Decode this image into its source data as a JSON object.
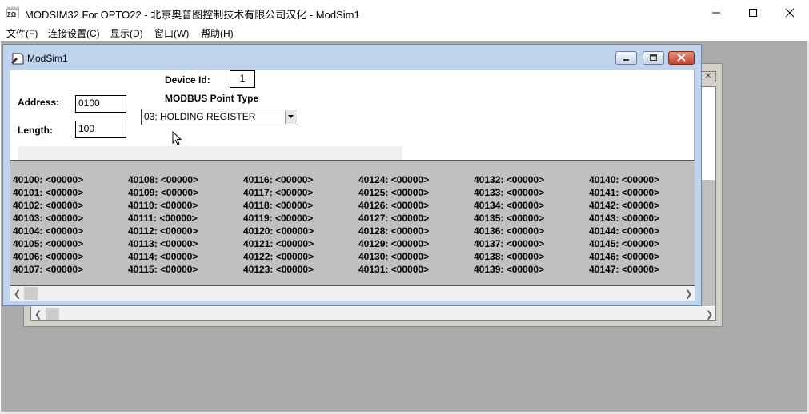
{
  "app": {
    "title": "MODSIM32 For OPTO22 - 北京奥普图控制技术有限公司汉化 - ModSim1",
    "icon": "modsim-app-icon"
  },
  "menu": [
    {
      "label": "文件(F)"
    },
    {
      "label": "连接设置(C)"
    },
    {
      "label": "显示(D)"
    },
    {
      "label": "窗口(W)"
    },
    {
      "label": "帮助(H)"
    }
  ],
  "child": {
    "title": "ModSim1",
    "address_label": "Address:",
    "address_value": "0100",
    "length_label": "Length:",
    "length_value": "100",
    "device_id_label": "Device Id:",
    "device_id_value": "1",
    "point_type_label": "MODBUS Point Type",
    "point_type_value": "03: HOLDING REGISTER"
  },
  "registers": {
    "columns": [
      [
        "40100: <00000>",
        "40101: <00000>",
        "40102: <00000>",
        "40103: <00000>",
        "40104: <00000>",
        "40105: <00000>",
        "40106: <00000>",
        "40107: <00000>"
      ],
      [
        "40108: <00000>",
        "40109: <00000>",
        "40110: <00000>",
        "40111: <00000>",
        "40112: <00000>",
        "40113: <00000>",
        "40114: <00000>",
        "40115: <00000>"
      ],
      [
        "40116: <00000>",
        "40117: <00000>",
        "40118: <00000>",
        "40119: <00000>",
        "40120: <00000>",
        "40121: <00000>",
        "40122: <00000>",
        "40123: <00000>"
      ],
      [
        "40124: <00000>",
        "40125: <00000>",
        "40126: <00000>",
        "40127: <00000>",
        "40128: <00000>",
        "40129: <00000>",
        "40130: <00000>",
        "40131: <00000>"
      ],
      [
        "40132: <00000>",
        "40133: <00000>",
        "40134: <00000>",
        "40135: <00000>",
        "40136: <00000>",
        "40137: <00000>",
        "40138: <00000>",
        "40139: <00000>"
      ],
      [
        "40140: <00000>",
        "40141: <00000>",
        "40142: <00000>",
        "40143: <00000>",
        "40144: <00000>",
        "40145: <00000>",
        "40146: <00000>",
        "40147: <00000>"
      ]
    ]
  },
  "colors": {
    "mdi_background": "#ababab",
    "child_frame": "#bfd3ec",
    "register_area": "#c0c0c0"
  }
}
